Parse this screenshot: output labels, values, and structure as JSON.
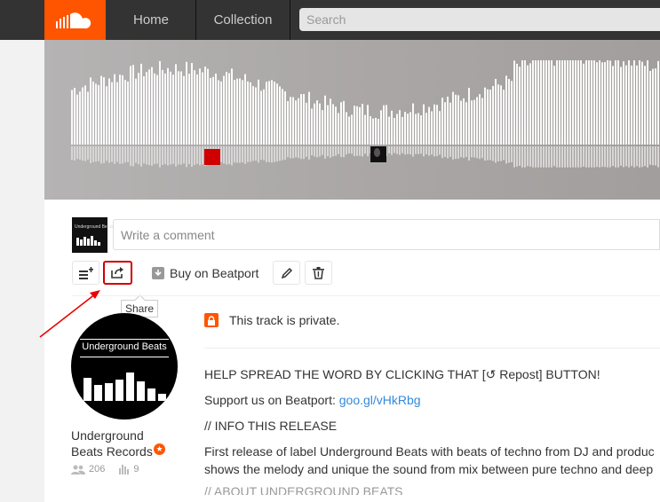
{
  "header": {
    "nav": [
      {
        "label": "Home"
      },
      {
        "label": "Collection"
      }
    ],
    "search_placeholder": "Search",
    "logo_icon": "soundcloud-logo-icon"
  },
  "player": {
    "comment_placeholder": "Write a comment",
    "avatar_text": "Underground Beats"
  },
  "actions": {
    "buy_label": "Buy on Beatport",
    "share_tooltip": "Share",
    "icons": [
      "add-to-playlist-icon",
      "share-icon",
      "download-icon",
      "pencil-icon",
      "trash-icon"
    ]
  },
  "artist": {
    "picture_text": "Underground Beats",
    "name": "Underground Beats Records",
    "pro_badge": "★",
    "followers": "206",
    "tracks": "9"
  },
  "track": {
    "private_notice": "This track is private."
  },
  "description": {
    "line1": "HELP SPREAD THE WORD BY CLICKING THAT [↺ Repost] BUTTON!",
    "line2_prefix": "Support us on Beatport: ",
    "line2_link": "goo.gl/vHkRbg",
    "line3": "// INFO THIS RELEASE",
    "line4": "First release of label Underground Beats with beats of techno from DJ and produc",
    "line5": "shows the melody and unique the sound from mix between pure techno and deep",
    "line6": "// ABOUT UNDERGROUND BEATS"
  },
  "colors": {
    "brand": "#ff5500",
    "header_bg": "#333333",
    "highlight": "#d10000",
    "link": "#3388dd"
  }
}
